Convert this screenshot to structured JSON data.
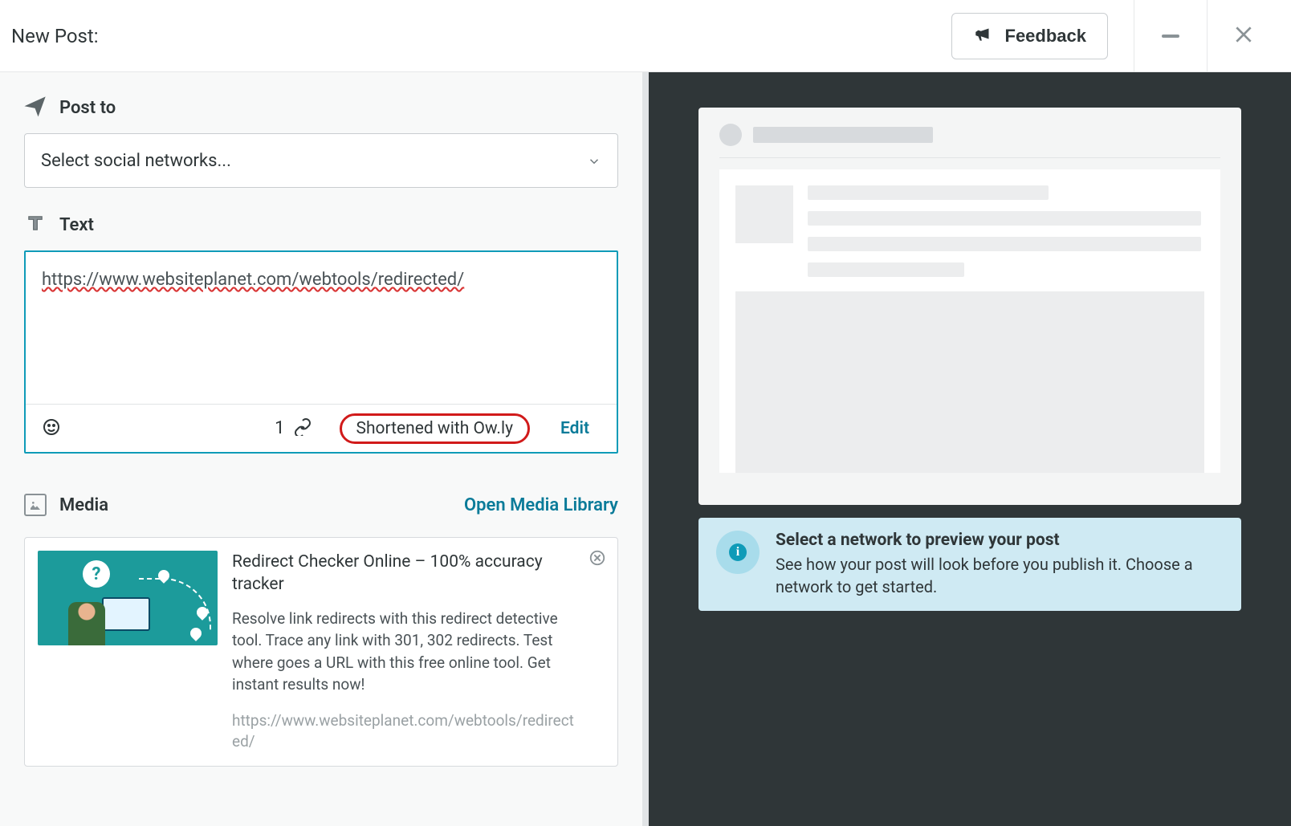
{
  "topbar": {
    "title": "New Post:",
    "feedback_label": "Feedback"
  },
  "sections": {
    "post_to": {
      "title": "Post to",
      "select_placeholder": "Select social networks..."
    },
    "text": {
      "title": "Text",
      "value": "https://www.websiteplanet.com/webtools/redirected/",
      "link_count": "1",
      "shortened_label": "Shortened with Ow.ly",
      "edit_label": "Edit"
    },
    "media": {
      "title": "Media",
      "open_label": "Open Media Library",
      "card": {
        "title": "Redirect Checker Online – 100% accuracy tracker",
        "description": "Resolve link redirects with this redirect detective tool. Trace any link with 301, 302 redirects. Test where goes a URL with this free online tool. Get instant results now!",
        "url": "https://www.websiteplanet.com/webtools/redirected/"
      }
    }
  },
  "preview": {
    "banner_title": "Select a network to preview your post",
    "banner_desc": "See how your post will look before you publish it. Choose a network to get started."
  }
}
